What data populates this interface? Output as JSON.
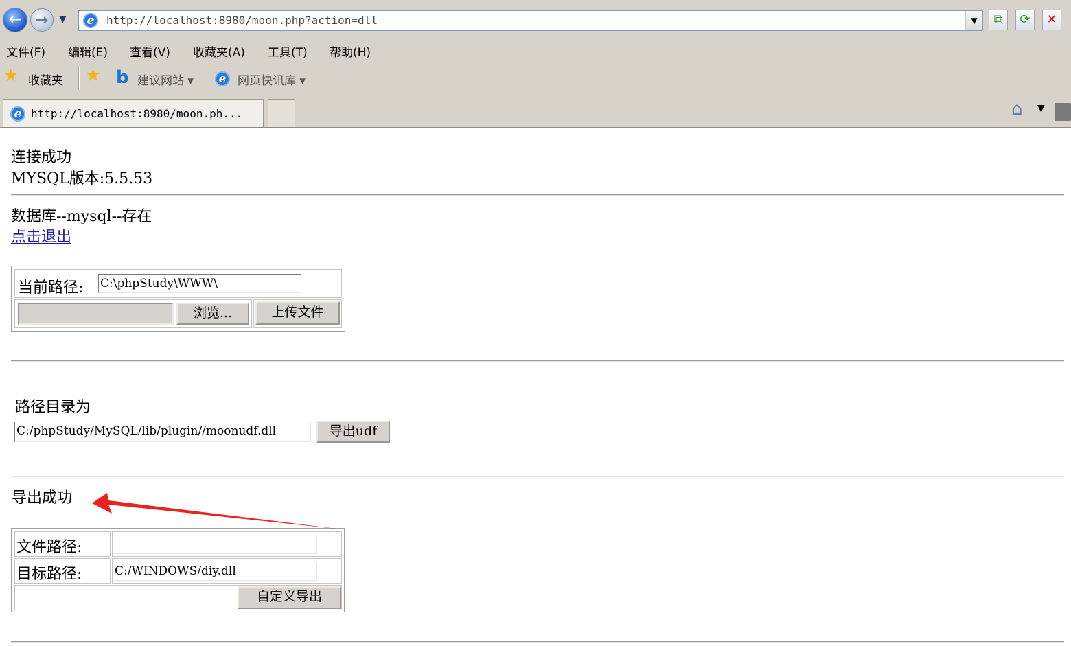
{
  "browser": {
    "address": "http://localhost:8980/moon.php?action=dll",
    "menu": [
      "文件(F)",
      "编辑(E)",
      "查看(V)",
      "收藏夹(A)",
      "工具(T)",
      "帮助(H)"
    ],
    "favorites": {
      "label": "收藏夹",
      "suggested_sites": "建议网站 ▾",
      "web_slice": "网页快讯库 ▾"
    },
    "tab_title": "http://localhost:8980/moon.ph..."
  },
  "page": {
    "connect_status": "连接成功",
    "mysql_version": "MYSQL版本:5.5.53",
    "db_status": "数据库--mysql--存在",
    "logout_link": "点击退出",
    "upload": {
      "current_path_label": "当前路径:",
      "current_path_value": "C:\\phpStudy\\WWW\\",
      "browse_button": "浏览...",
      "upload_button": "上传文件"
    },
    "dir_label": "路径目录为",
    "export_path_value": "C:/phpStudy/MySQL/lib/plugin//moonudf.dll",
    "export_button": "导出udf",
    "export_result": "导出成功",
    "custom": {
      "file_path_label": "文件路径:",
      "file_path_value": "",
      "target_path_label": "目标路径:",
      "target_path_value": "C:/WINDOWS/diy.dll",
      "export_button": "自定义导出"
    }
  },
  "annotation": {
    "arrow_color": "#e8231e"
  }
}
